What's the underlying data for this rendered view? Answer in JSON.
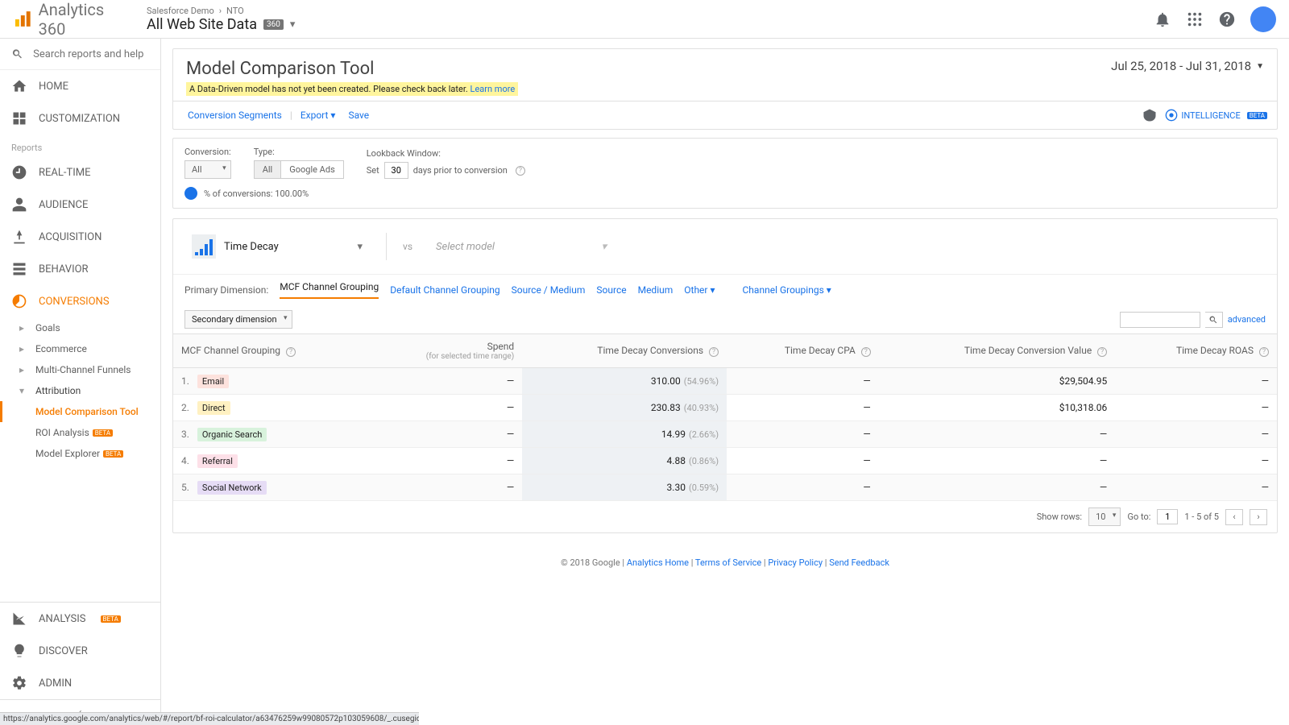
{
  "brand": "Analytics 360",
  "breadcrumb": {
    "org": "Salesforce Demo",
    "account": "NTO",
    "view": "All Web Site Data",
    "badge": "360"
  },
  "search_placeholder": "Search reports and help",
  "nav": {
    "home": "HOME",
    "customization": "CUSTOMIZATION",
    "reports_label": "Reports",
    "realtime": "REAL-TIME",
    "audience": "AUDIENCE",
    "acquisition": "ACQUISITION",
    "behavior": "BEHAVIOR",
    "conversions": "CONVERSIONS",
    "goals": "Goals",
    "ecommerce": "Ecommerce",
    "mcf": "Multi-Channel Funnels",
    "attribution": "Attribution",
    "mct": "Model Comparison Tool",
    "roi": "ROI Analysis",
    "explorer": "Model Explorer",
    "analysis": "ANALYSIS",
    "discover": "DISCOVER",
    "admin": "ADMIN",
    "beta": "BETA"
  },
  "page": {
    "title": "Model Comparison Tool",
    "warning": "A Data-Driven model has not yet been created. Please check back later.",
    "learn_more": "Learn more",
    "date_range": "Jul 25, 2018 - Jul 31, 2018"
  },
  "toolbar": {
    "seg": "Conversion Segments",
    "export": "Export",
    "save": "Save",
    "intel": "INTELLIGENCE",
    "beta": "BETA"
  },
  "controls": {
    "conv_label": "Conversion:",
    "conv_value": "All",
    "type_label": "Type:",
    "type_all": "All",
    "type_ads": "Google Ads",
    "lookback_label": "Lookback Window:",
    "set": "Set",
    "days_value": "30",
    "days_after": "days prior to conversion",
    "pct_line": "% of conversions: 100.00%"
  },
  "models": {
    "left": "Time Decay",
    "vs": "vs",
    "placeholder": "Select model"
  },
  "dims": {
    "label": "Primary Dimension:",
    "tabs": [
      "MCF Channel Grouping",
      "Default Channel Grouping",
      "Source / Medium",
      "Source",
      "Medium",
      "Other"
    ],
    "groupings": "Channel Groupings",
    "secondary": "Secondary dimension",
    "advanced": "advanced"
  },
  "columns": {
    "c0": "MCF Channel Grouping",
    "c1": "Spend",
    "c1_sub": "(for selected time range)",
    "c2": "Time Decay Conversions",
    "c3": "Time Decay CPA",
    "c4": "Time Decay Conversion Value",
    "c5": "Time Decay ROAS"
  },
  "rows": [
    {
      "n": "1.",
      "label": "Email",
      "color": "#fde2dd",
      "spend": "—",
      "conv": "310.00",
      "conv_pct": "(54.96%)",
      "cpa": "—",
      "val": "$29,504.95",
      "roas": "—"
    },
    {
      "n": "2.",
      "label": "Direct",
      "color": "#fff1c2",
      "spend": "—",
      "conv": "230.83",
      "conv_pct": "(40.93%)",
      "cpa": "—",
      "val": "$10,318.06",
      "roas": "—"
    },
    {
      "n": "3.",
      "label": "Organic Search",
      "color": "#d8f2dc",
      "spend": "—",
      "conv": "14.99",
      "conv_pct": "(2.66%)",
      "cpa": "—",
      "val": "—",
      "roas": "—"
    },
    {
      "n": "4.",
      "label": "Referral",
      "color": "#fde0e8",
      "spend": "—",
      "conv": "4.88",
      "conv_pct": "(0.86%)",
      "cpa": "—",
      "val": "—",
      "roas": "—"
    },
    {
      "n": "5.",
      "label": "Social Network",
      "color": "#e6dcf5",
      "spend": "—",
      "conv": "3.30",
      "conv_pct": "(0.59%)",
      "cpa": "—",
      "val": "—",
      "roas": "—"
    }
  ],
  "pager": {
    "show": "Show rows:",
    "rows": "10",
    "goto": "Go to:",
    "goto_val": "1",
    "range": "1 - 5 of 5"
  },
  "footer": {
    "copyright": "© 2018 Google",
    "links": [
      "Analytics Home",
      "Terms of Service",
      "Privacy Policy",
      "Send Feedback"
    ]
  },
  "status_url": "https://analytics.google.com/analytics/web/#/report/bf-roi-calculator/a63476259w99080572p103059608/_.cusegid%3Dcustom%2IE_r.attrSel1%3Dpreset4"
}
